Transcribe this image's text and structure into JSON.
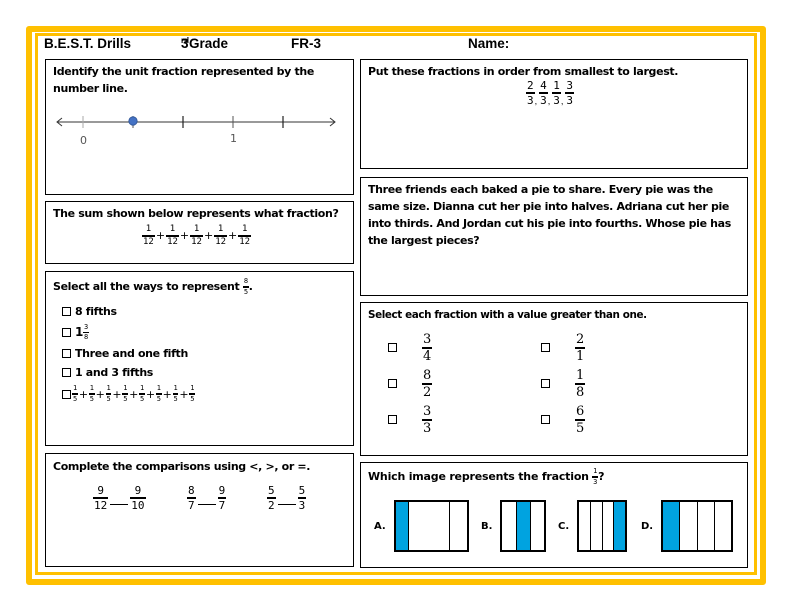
{
  "header": {
    "title": "B.E.S.T. Drills",
    "grade_num": "3",
    "grade_sup": "rd",
    "grade_label": "Grade",
    "code": "FR-3",
    "name_label": "Name:"
  },
  "colors": {
    "frame": "#FFC000",
    "shade": "#00A3E0",
    "point": "#4472C4"
  },
  "q1": {
    "prompt": "Identify the unit fraction represented by the number line.",
    "number_line": {
      "labels": [
        "0",
        "1"
      ],
      "ticks_per_unit": 3,
      "point_value_fraction": "1/3"
    }
  },
  "q2": {
    "prompt": "The sum shown below represents what fraction?",
    "terms": [
      {
        "n": "1",
        "d": "12"
      },
      {
        "n": "1",
        "d": "12"
      },
      {
        "n": "1",
        "d": "12"
      },
      {
        "n": "1",
        "d": "12"
      },
      {
        "n": "1",
        "d": "12"
      }
    ],
    "operator": "+"
  },
  "q3": {
    "prompt": "Select all the ways to represent",
    "target": {
      "n": "8",
      "d": "5"
    },
    "period": ".",
    "options": [
      {
        "type": "text",
        "text": "8 fifths"
      },
      {
        "type": "mixed",
        "whole": "1",
        "n": "3",
        "d": "8"
      },
      {
        "type": "text",
        "text": "Three and one fifth"
      },
      {
        "type": "text",
        "text": "1 and 3 fifths"
      },
      {
        "type": "sum",
        "terms": [
          {
            "n": "1",
            "d": "5"
          },
          {
            "n": "1",
            "d": "5"
          },
          {
            "n": "1",
            "d": "5"
          },
          {
            "n": "1",
            "d": "5"
          },
          {
            "n": "1",
            "d": "5"
          },
          {
            "n": "1",
            "d": "5"
          },
          {
            "n": "1",
            "d": "5"
          },
          {
            "n": "1",
            "d": "5"
          }
        ]
      }
    ]
  },
  "q4": {
    "prompt": "Complete the comparisons using <, >, or =.",
    "pairs": [
      {
        "a": {
          "n": "9",
          "d": "12"
        },
        "b": {
          "n": "9",
          "d": "10"
        }
      },
      {
        "a": {
          "n": "8",
          "d": "7"
        },
        "b": {
          "n": "9",
          "d": "7"
        }
      },
      {
        "a": {
          "n": "5",
          "d": "2"
        },
        "b": {
          "n": "5",
          "d": "3"
        }
      }
    ]
  },
  "q5": {
    "prompt": "Put these fractions in order from smallest to largest.",
    "fractions": [
      {
        "n": "2",
        "d": "3"
      },
      {
        "n": "4",
        "d": "3"
      },
      {
        "n": "1",
        "d": "3"
      },
      {
        "n": "3",
        "d": "3"
      }
    ],
    "separator": ","
  },
  "q6": {
    "prompt": "Three friends each baked a pie to share.  Every pie was the same size.  Dianna cut her pie into halves.  Adriana cut her pie into thirds.  And Jordan cut his pie into fourths.  Whose pie has the largest pieces?"
  },
  "q7": {
    "prompt": "Select each fraction with a value greater than one.",
    "left": [
      {
        "n": "3",
        "d": "4"
      },
      {
        "n": "8",
        "d": "2"
      },
      {
        "n": "3",
        "d": "3"
      }
    ],
    "right": [
      {
        "n": "2",
        "d": "1"
      },
      {
        "n": "1",
        "d": "8"
      },
      {
        "n": "6",
        "d": "5"
      }
    ]
  },
  "q8": {
    "prompt": "Which image represents the fraction",
    "target": {
      "n": "1",
      "d": "3"
    },
    "qmark": "?",
    "options": [
      {
        "label": "A.",
        "parts": 3,
        "shaded_index": 0,
        "equal": false
      },
      {
        "label": "B.",
        "parts": 3,
        "shaded_index": 1,
        "equal": true
      },
      {
        "label": "C.",
        "parts": 4,
        "shaded_index": 3,
        "equal": true
      },
      {
        "label": "D.",
        "parts": 4,
        "shaded_index": 0,
        "equal": true
      }
    ]
  }
}
